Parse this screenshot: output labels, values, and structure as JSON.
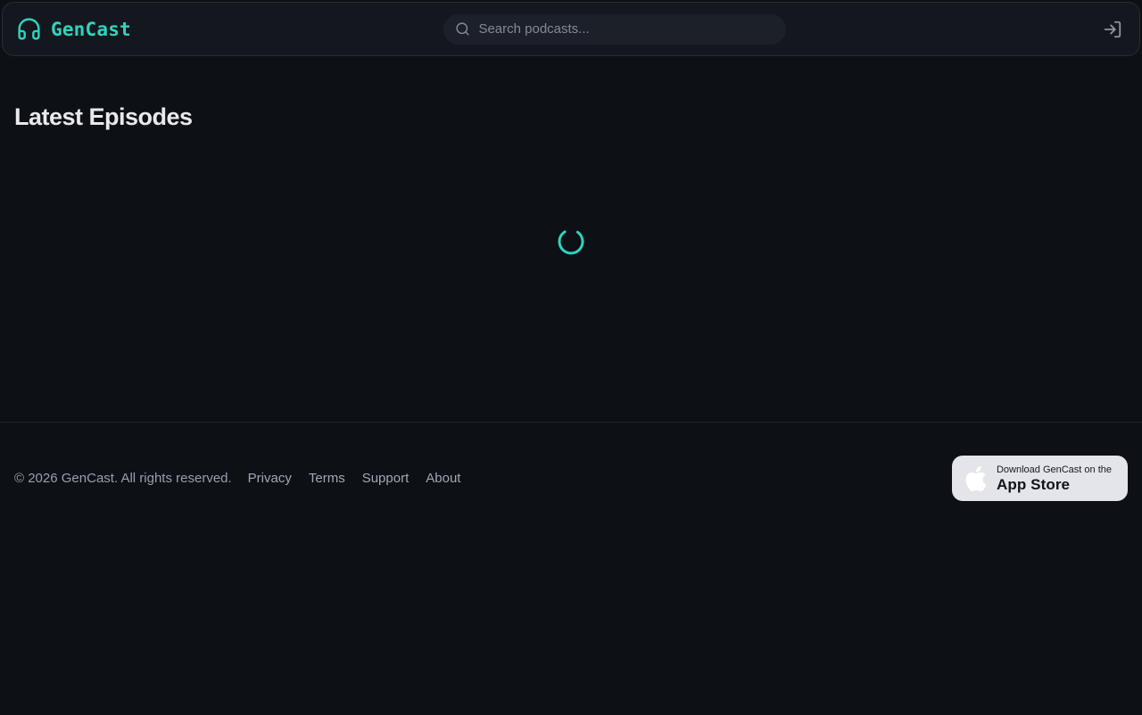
{
  "brand": {
    "name": "GenCast"
  },
  "header": {
    "search_placeholder": "Search podcasts..."
  },
  "main": {
    "title": "Latest Episodes"
  },
  "loading": {
    "state": "spinner-visible"
  },
  "footer": {
    "copyright": "© 2026 GenCast. All rights reserved.",
    "links": [
      "Privacy",
      "Terms",
      "Support",
      "About"
    ],
    "appstore_line1": "Download GenCast on the",
    "appstore_line2": "App Store"
  },
  "colors": {
    "accent": "#2dd4bf",
    "page_bg": "#0d1015",
    "header_bg": "#14171d",
    "search_bg": "#1c2028",
    "appstore_button_bg": "#e3e5ea",
    "muted_text": "#97a0ac"
  },
  "icons": {
    "logo": "headphones-icon",
    "search": "search-icon",
    "auth": "login-icon",
    "store": "apple-icon",
    "loading": "spinner-icon"
  }
}
